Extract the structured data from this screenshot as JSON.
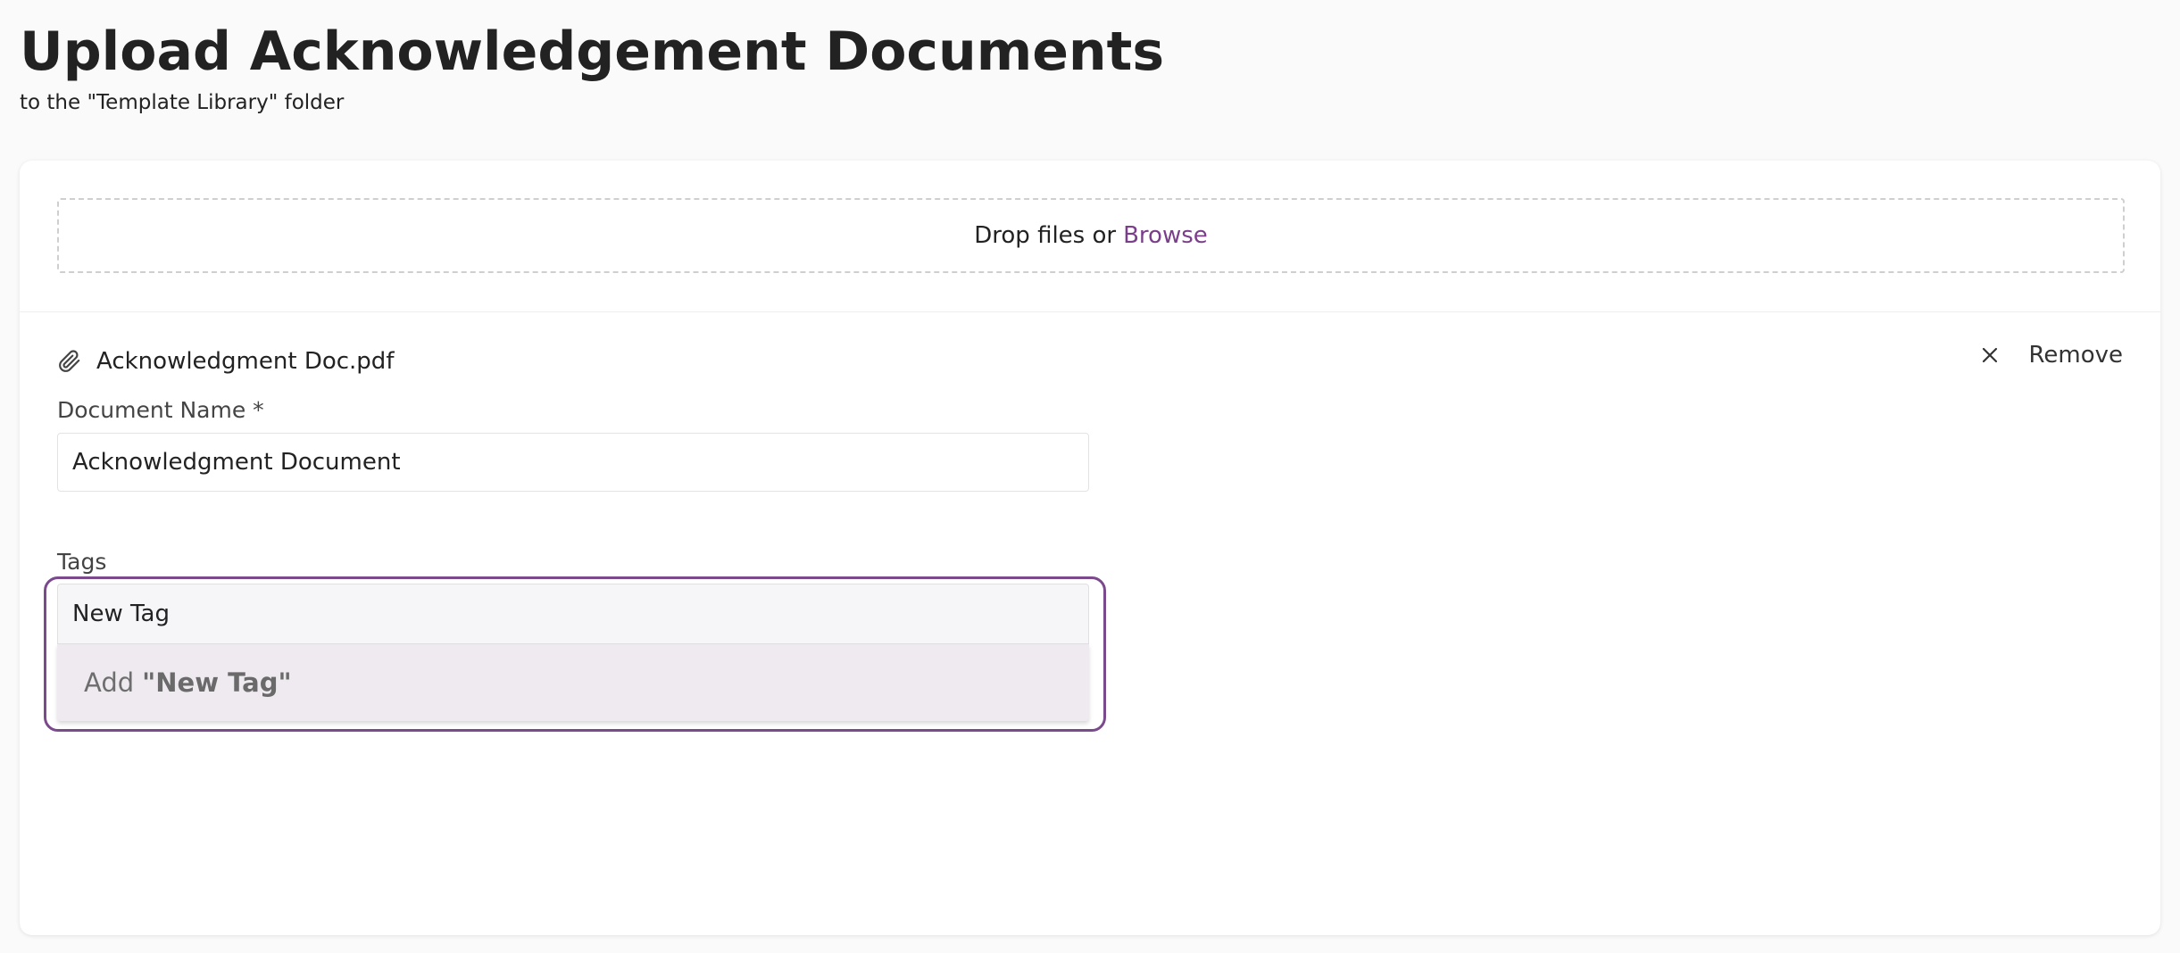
{
  "header": {
    "title": "Upload Acknowledgement Documents",
    "subtitle": "to the \"Template Library\" folder"
  },
  "dropzone": {
    "text": "Drop files or",
    "browse_label": "Browse"
  },
  "file": {
    "icon": "paperclip-icon",
    "name": "Acknowledgment Doc.pdf",
    "remove_icon": "close-icon",
    "remove_label": "Remove"
  },
  "document_name": {
    "label": "Document Name *",
    "value": "Acknowledgment Document"
  },
  "tags": {
    "label": "Tags",
    "value": "New Tag",
    "option_prefix": "Add",
    "option_value": "\"New Tag\""
  },
  "colors": {
    "accent": "#7a4a8c",
    "link": "#7a3e8a",
    "dropdown_bg": "#eeeaf0"
  }
}
